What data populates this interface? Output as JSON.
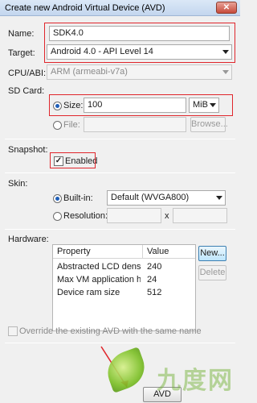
{
  "window": {
    "title": "Create new Android Virtual Device (AVD)",
    "close_glyph": "✕"
  },
  "name": {
    "label": "Name:",
    "value": "SDK4.0"
  },
  "target": {
    "label": "Target:",
    "value": "Android 4.0 - API Level 14"
  },
  "cpu": {
    "label": "CPU/ABI:",
    "value": "ARM (armeabi-v7a)"
  },
  "sdcard": {
    "label": "SD Card:",
    "size_label": "Size:",
    "size_value": "100",
    "size_unit": "MiB",
    "file_label": "File:",
    "file_value": "",
    "browse_label": "Browse..."
  },
  "snapshot": {
    "label": "Snapshot:",
    "enabled_label": "Enabled",
    "checked": true
  },
  "skin": {
    "label": "Skin:",
    "builtin_label": "Built-in:",
    "builtin_value": "Default (WVGA800)",
    "resolution_label": "Resolution:",
    "res_width": "",
    "res_x": "x",
    "res_height": ""
  },
  "hardware": {
    "label": "Hardware:",
    "columns": [
      "Property",
      "Value"
    ],
    "rows": [
      {
        "property": "Abstracted LCD density",
        "value": "240"
      },
      {
        "property": "Max VM application h...",
        "value": "24"
      },
      {
        "property": "Device ram size",
        "value": "512"
      }
    ],
    "new_label": "New...",
    "delete_label": "Delete"
  },
  "override": {
    "label": "Override the existing AVD with the same name",
    "checked": false
  },
  "footer": {
    "create_label": "AVD"
  },
  "watermark": {
    "text": "九度网"
  },
  "colors": {
    "highlight": "#e0262c",
    "accent": "#1f5fb8"
  }
}
